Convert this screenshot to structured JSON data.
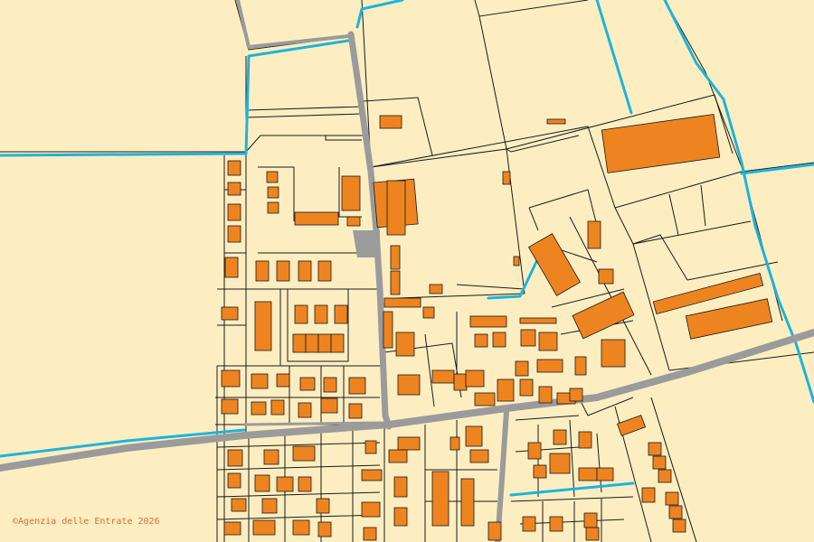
{
  "map": {
    "attribution": "Agenzia delle Entrate 2026",
    "attribution_symbol": "©",
    "colors": {
      "background": "#fdeec2",
      "parcel_line": "#1a1a1a",
      "building_fill": "#ee8420",
      "road": "#9b9b9b",
      "water": "#1fb3d9",
      "attribution_text": "#e06a3a"
    }
  }
}
